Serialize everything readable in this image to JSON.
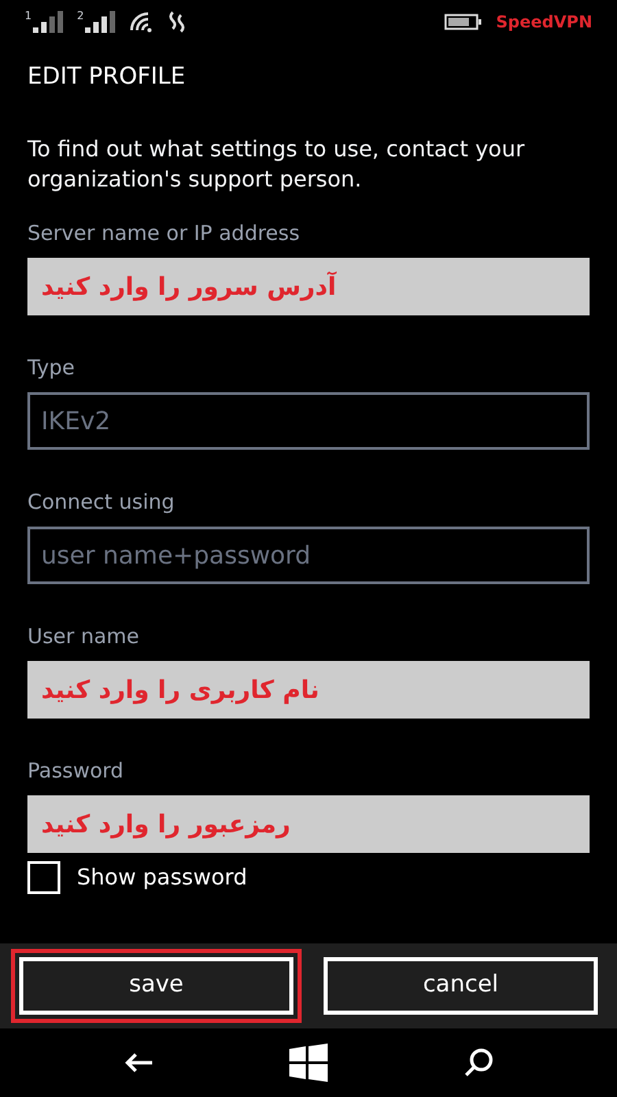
{
  "status_bar": {
    "sim_labels": [
      "1",
      "2"
    ],
    "vpn_label": "SpeedVPN"
  },
  "title": "EDIT PROFILE",
  "intro": "To find out what settings to use, contact your organization's support person.",
  "fields": [
    {
      "label": "Server name or IP address",
      "value": "آدرس سرور را وارد کنید",
      "disabled": false,
      "annotated": true
    },
    {
      "label": "Type",
      "value": "IKEv2",
      "disabled": true,
      "annotated": false
    },
    {
      "label": "Connect using",
      "value": "user name+password",
      "disabled": true,
      "annotated": false
    },
    {
      "label": "User name",
      "value": "نام کاربری را وارد کنید",
      "disabled": false,
      "annotated": true
    },
    {
      "label": "Password",
      "value": "رمزعبور را وارد کنید",
      "disabled": false,
      "annotated": true
    }
  ],
  "show_password": {
    "label": "Show password",
    "checked": false
  },
  "buttons": [
    {
      "label": "save",
      "highlighted": true
    },
    {
      "label": "cancel",
      "highlighted": false
    }
  ]
}
